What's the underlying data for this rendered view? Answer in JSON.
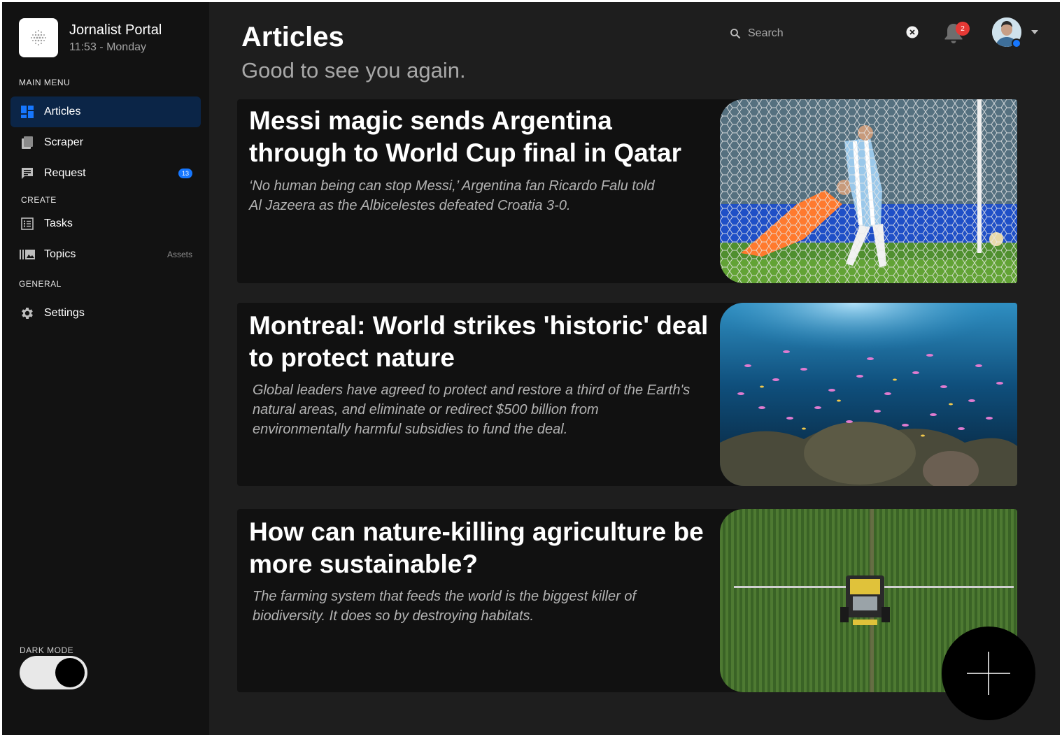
{
  "app": {
    "title": "Jornalist Portal",
    "time": "11:53 - Monday"
  },
  "sidebar": {
    "main_menu_label": "MAIN MENU",
    "create_label": "CREATE",
    "general_label": "GENERAL",
    "items": [
      {
        "label": "Articles",
        "icon": "grid-icon",
        "active": true
      },
      {
        "label": "Scraper",
        "icon": "document-icon"
      },
      {
        "label": "Request",
        "icon": "chat-icon",
        "badge": "13"
      },
      {
        "label": "Tasks",
        "icon": "list-icon"
      },
      {
        "label": "Topics",
        "icon": "gallery-icon",
        "hint": "Assets"
      },
      {
        "label": "Settings",
        "icon": "gear-icon"
      }
    ],
    "dark_mode_label": "DARK MODE",
    "dark_mode_on": true
  },
  "header": {
    "title": "Articles",
    "subtitle": "Good to see you again.",
    "search_placeholder": "Search",
    "notification_count": "2"
  },
  "articles": [
    {
      "title": "Messi magic sends Argentina through to World Cup final in Qatar",
      "description": "‘No human being can stop Messi,’ Argentina fan Ricardo Falu told Al Jazeera as the Albicelestes defeated Croatia 3-0."
    },
    {
      "title": "Montreal: World strikes 'historic' deal to protect nature",
      "description": "Global leaders have agreed to protect and restore a third of the Earth's natural areas, and eliminate or redirect $500 billion from environmentally harmful subsidies to fund the deal."
    },
    {
      "title": "How can nature-killing agriculture be more sustainable?",
      "description": "The farming system that feeds the world is the biggest killer of biodiversity. It does so by destroying habitats."
    }
  ],
  "colors": {
    "accent": "#1677ff",
    "active_bg": "#0b2547",
    "sidebar_bg": "#121212",
    "main_bg": "#1e1e1e",
    "badge_red": "#e53935"
  }
}
